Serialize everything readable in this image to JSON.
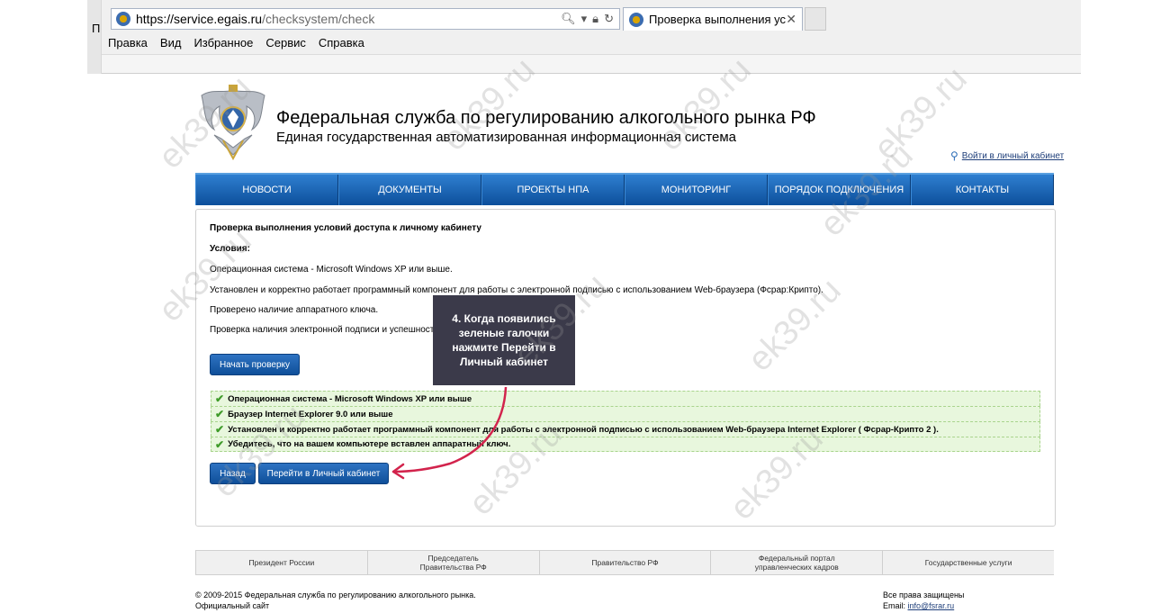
{
  "browser": {
    "left_caption": "П",
    "url_host": "https://service.egais.ru",
    "url_rest": "/checksystem/check",
    "tab_title": "Проверка выполнения усл...",
    "menu": [
      "Правка",
      "Вид",
      "Избранное",
      "Сервис",
      "Справка"
    ]
  },
  "site": {
    "title": "Федеральная служба по регулированию алкогольного рынка РФ",
    "subtitle": "Единая государственная автоматизированная информационная система",
    "login_link": "Войти в личный кабинет"
  },
  "nav": [
    "НОВОСТИ",
    "ДОКУМЕНТЫ",
    "ПРОЕКТЫ НПА",
    "МОНИТОРИНГ",
    "ПОРЯДОК ПОДКЛЮЧЕНИЯ",
    "КОНТАКТЫ"
  ],
  "content": {
    "heading": "Проверка выполнения условий доступа к личному кабинету",
    "conditions_label": "Условия:",
    "conditions": [
      "Операционная система - Microsoft Windows XP или выше.",
      "Установлен и корректно работает программный компонент для работы с электронной подписью с использованием Web-браузера (Фсрар:Крипто).",
      "Проверено наличие аппаратного ключа.",
      "Проверка наличия электронной подписи и успешности"
    ],
    "start_button": "Начать проверку",
    "checks": [
      "Операционная система - Microsoft Windows XP или выше",
      "Браузер Internet Explorer 9.0 или выше",
      "Установлен и корректно работает программный компонент для работы с электронной подписью с использованием Web-браузера Internet Explorer ( Фсрар-Крипто 2 ).",
      "Убедитесь, что на вашем компьютере вставлен аппаратный ключ."
    ],
    "back_button": "Назад",
    "cabinet_button": "Перейти в Личный кабинет"
  },
  "tooltip": {
    "text": "4. Когда появились зеленые галочки нажмите Перейти в Личный кабинет"
  },
  "footer": {
    "links": [
      "Президент России",
      "Председатель\nПравительства РФ",
      "Правительство РФ",
      "Федеральный портал\nуправленческих кадров",
      "Государственные услуги"
    ],
    "copyright_line1": "© 2009-2015 Федеральная служба по регулированию алкогольного рынка.",
    "copyright_line2": "Официальный сайт",
    "rights": "Все права защищены",
    "email_label": "Email:",
    "email": "info@fsrar.ru"
  },
  "watermark": "ek39.ru",
  "colors": {
    "nav_top": "#2e7fd0",
    "nav_bottom": "#0d4f9b",
    "check_bg": "#e8f7dd",
    "check_tick": "#3f9b2a",
    "tooltip_bg": "#3b3a4a",
    "arrow": "#d2234c"
  }
}
